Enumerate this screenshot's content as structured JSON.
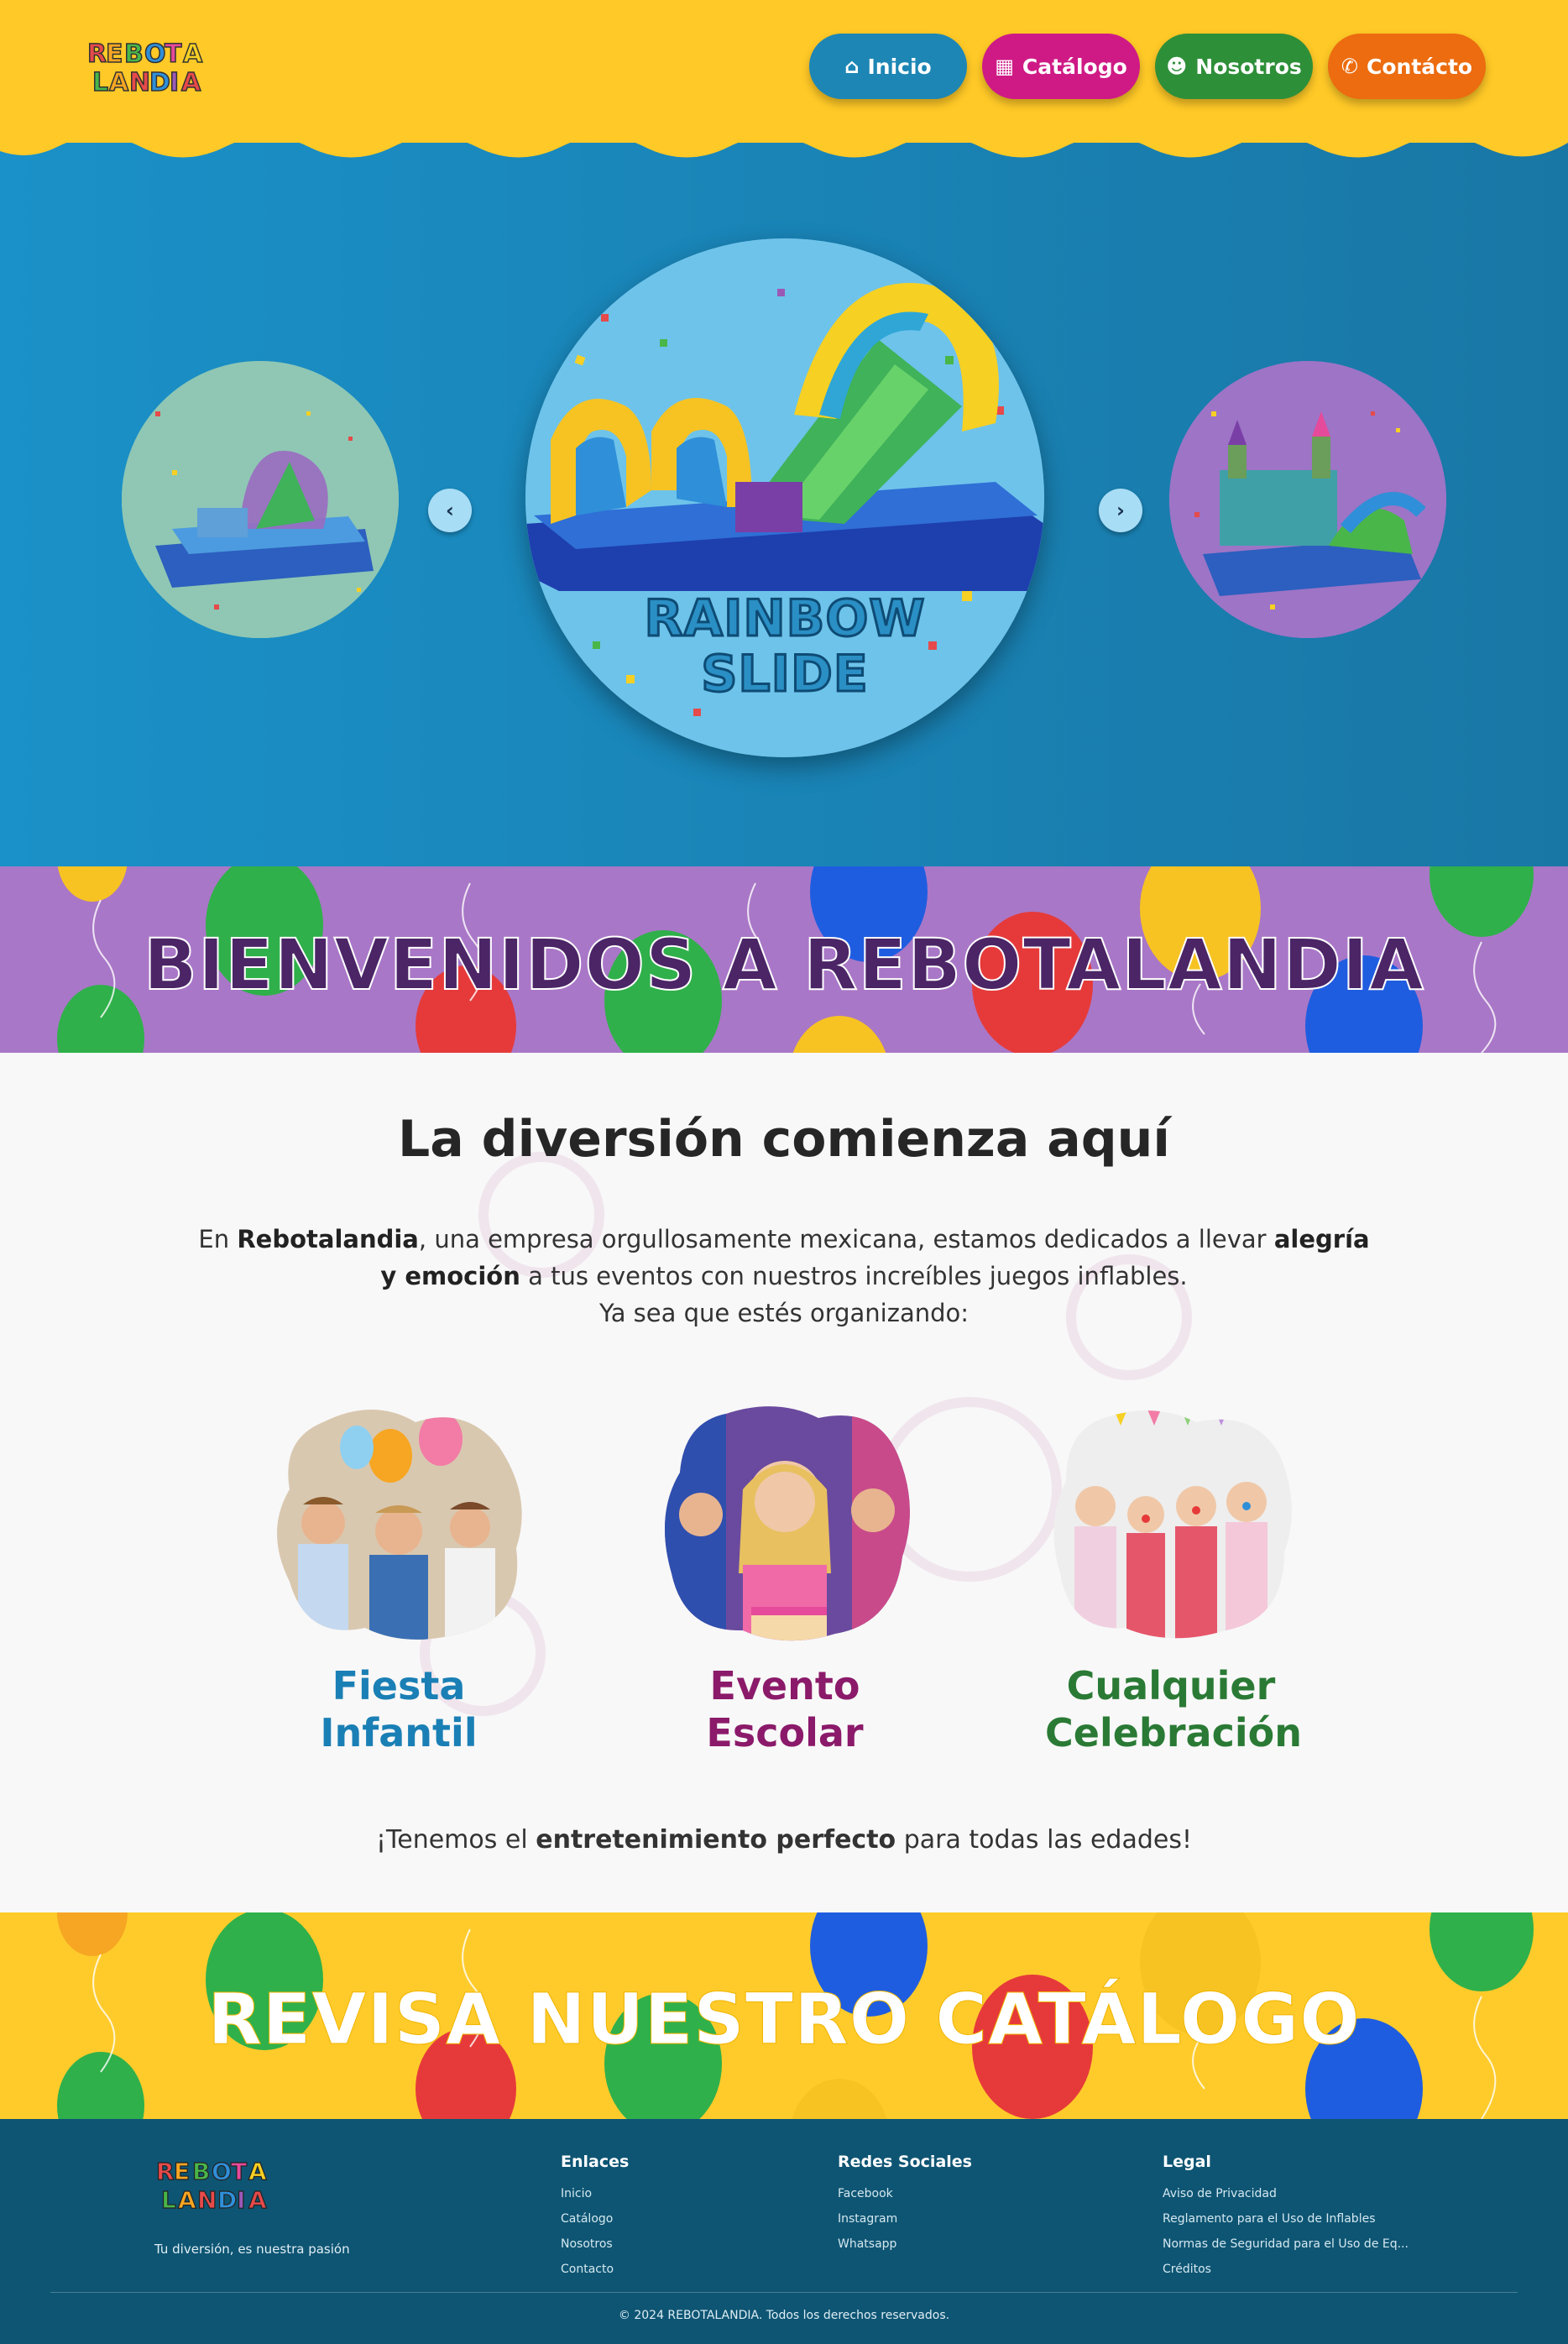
{
  "header": {
    "logo_alt": "Rebotalandia",
    "nav": [
      {
        "label": "Inicio",
        "icon": "home-icon"
      },
      {
        "label": "Catálogo",
        "icon": "grid-icon"
      },
      {
        "label": "Nosotros",
        "icon": "users-icon"
      },
      {
        "label": "Contácto",
        "icon": "phone-icon"
      }
    ]
  },
  "hero": {
    "main_title_line1": "RAINBOW",
    "main_title_line2": "SLIDE",
    "prev_label": "‹",
    "next_label": "›"
  },
  "welcome": {
    "title": "BIENVENIDOS A REBOTALANDIA"
  },
  "about": {
    "heading": "La diversión comienza aquí",
    "text_1": "En ",
    "text_brand": "Rebotalandia",
    "text_2": ", una empresa orgullosamente mexicana, estamos dedicados a llevar ",
    "text_bold": "alegría y emoción",
    "text_3": " a tus eventos con nuestros increíbles juegos inflables.",
    "text_4": "Ya sea que estés organizando:",
    "occasions": [
      {
        "line1": "Fiesta",
        "line2": "Infantil"
      },
      {
        "line1": "Evento",
        "line2": "Escolar"
      },
      {
        "line1": "Cualquier",
        "line2": "Celebración"
      }
    ],
    "closing_1": "¡Tenemos el ",
    "closing_bold": "entretenimiento perfecto",
    "closing_2": " para todas las edades!"
  },
  "catalog_banner": {
    "title": "REVISA NUESTRO CATÁLOGO"
  },
  "footer": {
    "tagline": "Tu diversión, es nuestra pasión",
    "enlaces": {
      "title": "Enlaces",
      "links": [
        "Inicio",
        "Catálogo",
        "Nosotros",
        "Contacto"
      ]
    },
    "redes": {
      "title": "Redes Sociales",
      "links": [
        "Facebook",
        "Instagram",
        "Whatsapp"
      ]
    },
    "legal": {
      "title": "Legal",
      "links": [
        "Aviso de Privacidad",
        "Reglamento para el Uso de Inflables",
        "Normas de Seguridad para el Uso de Eq...",
        "Créditos"
      ]
    },
    "copyright": "© 2024 REBOTALANDIA. Todos los derechos reservados."
  },
  "colors": {
    "header_yellow": "#ffc927",
    "hero_blue": "#1a91c8",
    "welcome_purple": "#a977c7",
    "catalog_yellow": "#ffcb2b",
    "footer_teal": "#0e5573",
    "inicio_blue": "#1d86b5",
    "catalogo_magenta": "#cf1a86",
    "nosotros_green": "#2e8f39",
    "contacto_orange": "#ec6c0f"
  }
}
